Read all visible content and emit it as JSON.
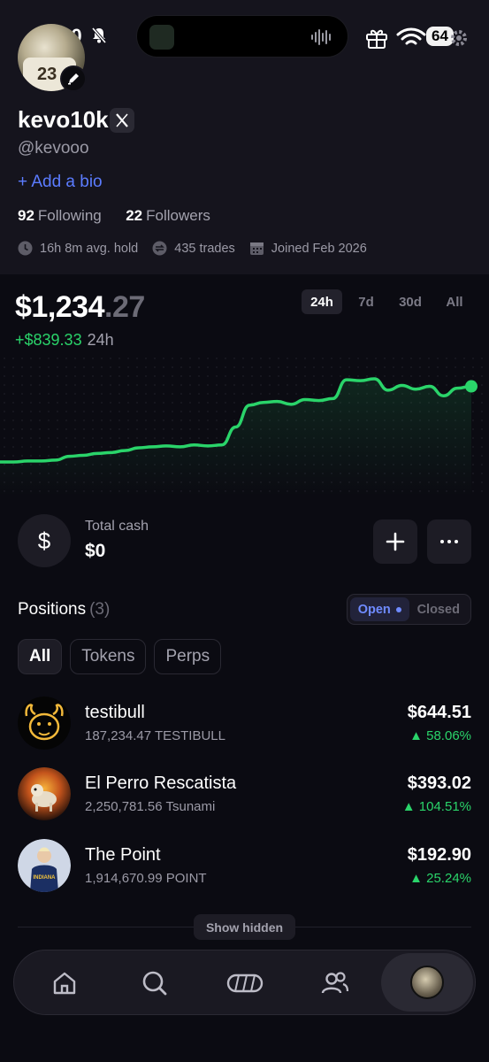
{
  "status": {
    "time": "9:30",
    "battery": "64"
  },
  "profile": {
    "username": "kevo10k",
    "handle": "@kevooo",
    "add_bio": "+ Add a bio",
    "following_count": "92",
    "following_label": "Following",
    "followers_count": "22",
    "followers_label": "Followers",
    "avg_hold": "16h 8m avg. hold",
    "trades": "435 trades",
    "joined": "Joined Feb 2026",
    "avatar_jersey": "23"
  },
  "portfolio": {
    "value_main": "$1,234",
    "value_cents": ".27",
    "pnl": "+$839.33",
    "pnl_period": "24h",
    "ranges": [
      "24h",
      "7d",
      "30d",
      "All"
    ],
    "active_range": "24h"
  },
  "chart_data": {
    "type": "line",
    "y": [
      10,
      10,
      11,
      11,
      12,
      16,
      17,
      19,
      20,
      22,
      25,
      26,
      27,
      26,
      28,
      27,
      28,
      47,
      70,
      73,
      74,
      71,
      76,
      75,
      77,
      97,
      96,
      98,
      86,
      91,
      87,
      90,
      80,
      88,
      90
    ],
    "color": "#2ad46a"
  },
  "cash": {
    "label": "Total cash",
    "value": "$0"
  },
  "positions": {
    "title": "Positions",
    "count": "(3)",
    "toggle_open": "Open",
    "toggle_closed": "Closed",
    "filters": [
      "All",
      "Tokens",
      "Perps"
    ],
    "items": [
      {
        "name": "testibull",
        "qty": "187,234.47 TESTIBULL",
        "value": "$644.51",
        "change": "▲ 58.06%"
      },
      {
        "name": "El Perro Rescatista",
        "qty": "2,250,781.56 Tsunami",
        "value": "$393.02",
        "change": "▲ 104.51%"
      },
      {
        "name": "The Point",
        "qty": "1,914,670.99 POINT",
        "value": "$192.90",
        "change": "▲ 25.24%"
      }
    ],
    "show_hidden": "Show hidden"
  },
  "nav": [
    "home-icon",
    "search-icon",
    "pill-icon",
    "users-icon",
    "profile-avatar"
  ]
}
